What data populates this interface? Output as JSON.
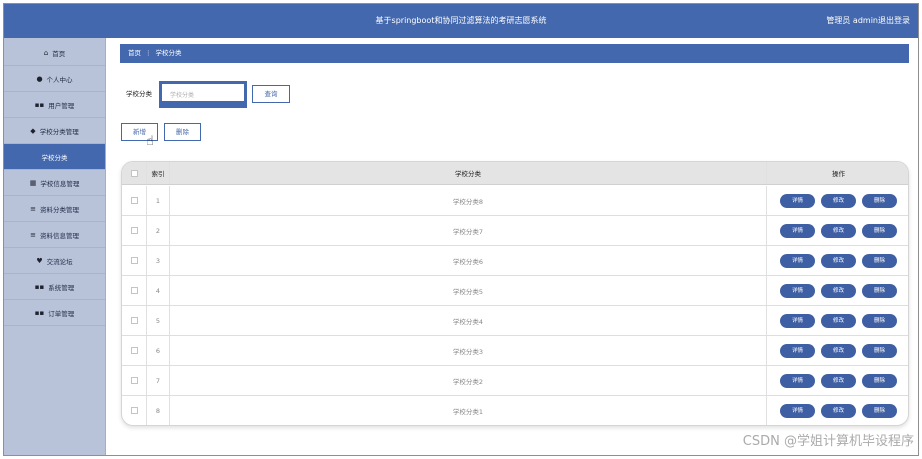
{
  "header": {
    "title": "基于springboot和协同过滤算法的考研志愿系统",
    "user_label": "管理员 admin",
    "logout_label": "退出登录"
  },
  "sidebar": {
    "items": [
      {
        "label": "首页",
        "icon": "home-icon"
      },
      {
        "label": "个人中心",
        "icon": "user-icon"
      },
      {
        "label": "用户管理",
        "icon": "grid-icon"
      },
      {
        "label": "学校分类管理",
        "icon": "tag-icon"
      },
      {
        "label": "学校分类",
        "icon": "",
        "active": true
      },
      {
        "label": "学校信息管理",
        "icon": "calendar-icon"
      },
      {
        "label": "资料分类管理",
        "icon": "list-icon"
      },
      {
        "label": "资料信息管理",
        "icon": "list-icon"
      },
      {
        "label": "交流论坛",
        "icon": "pin-icon"
      },
      {
        "label": "系统管理",
        "icon": "grid-icon"
      },
      {
        "label": "订单管理",
        "icon": "grid-icon"
      }
    ]
  },
  "breadcrumb": {
    "home": "首页",
    "separator": "⋮",
    "current": "学校分类"
  },
  "search": {
    "label": "学校分类",
    "placeholder": "学校分类",
    "button": "查询"
  },
  "actions": {
    "add": "新增",
    "delete": "删除"
  },
  "table": {
    "headers": {
      "index": "索引",
      "name": "学校分类",
      "ops": "操作"
    },
    "op_labels": {
      "detail": "详情",
      "edit": "修改",
      "delete": "删除"
    },
    "rows": [
      {
        "index": "1",
        "name": "学校分类8"
      },
      {
        "index": "2",
        "name": "学校分类7"
      },
      {
        "index": "3",
        "name": "学校分类6"
      },
      {
        "index": "4",
        "name": "学校分类5"
      },
      {
        "index": "5",
        "name": "学校分类4"
      },
      {
        "index": "6",
        "name": "学校分类3"
      },
      {
        "index": "7",
        "name": "学校分类2"
      },
      {
        "index": "8",
        "name": "学校分类1"
      }
    ]
  },
  "watermark": "CSDN @学姐计算机毕设程序",
  "colors": {
    "primary": "#4468ad",
    "sidebar": "#b8c2d8"
  }
}
